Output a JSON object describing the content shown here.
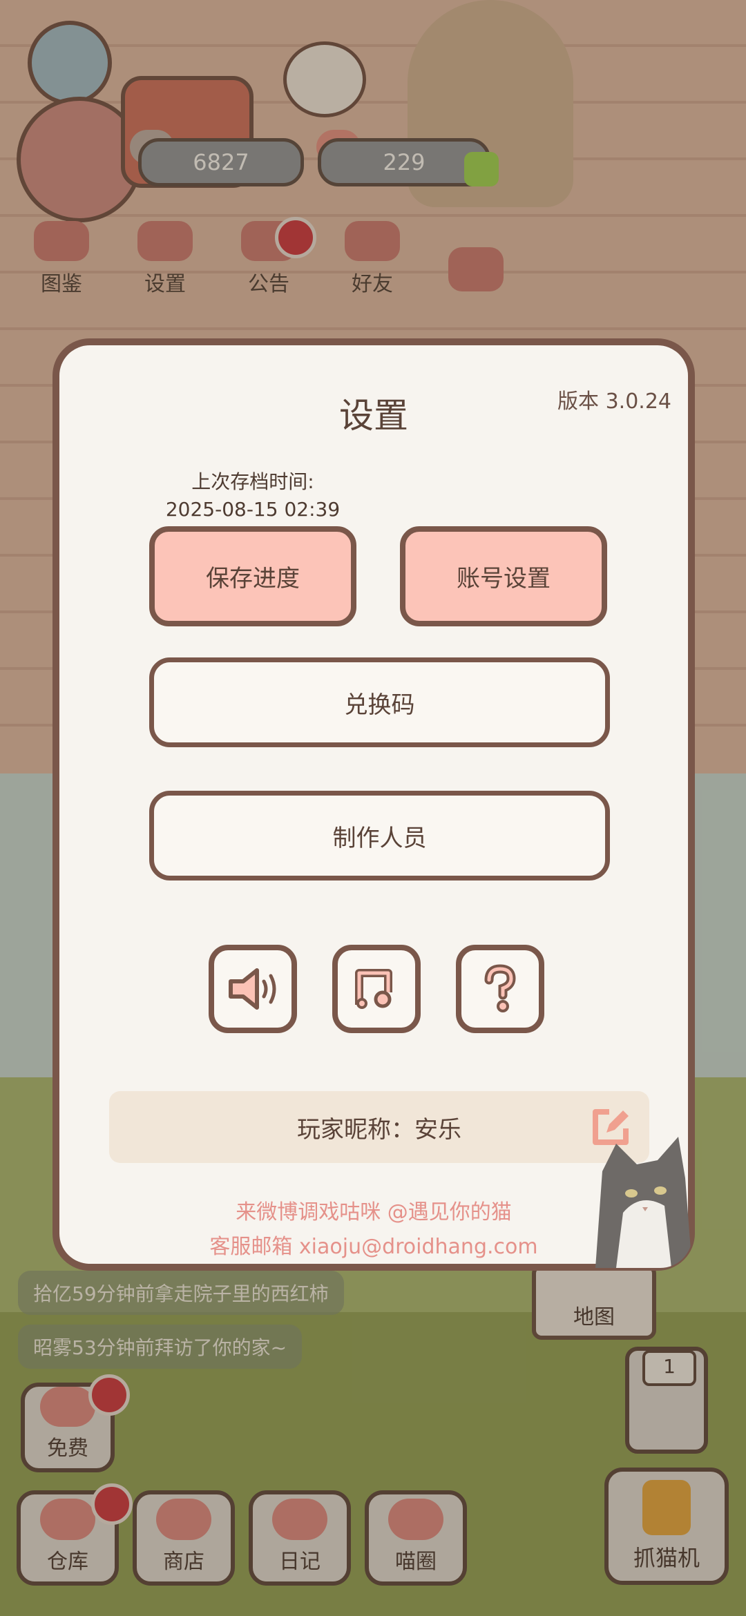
{
  "top_stats": {
    "coins": "6827",
    "fish": "229"
  },
  "top_nav": [
    {
      "label": "图鉴",
      "icon": "cat-book-icon"
    },
    {
      "label": "设置",
      "icon": "gear-icon"
    },
    {
      "label": "公告",
      "icon": "gift-icon"
    },
    {
      "label": "好友",
      "icon": "friends-icon"
    },
    {
      "label": "",
      "icon": "hearts-icon"
    }
  ],
  "dialog": {
    "title": "设置",
    "version": "版本 3.0.24",
    "last_save_label": "上次存档时间:",
    "last_save_time": "2025-08-15 02:39",
    "save_button": "保存进度",
    "account_button": "账号设置",
    "redeem_button": "兑换码",
    "credits_button": "制作人员",
    "icons": [
      "speaker-icon",
      "music-note-icon",
      "question-icon"
    ],
    "nickname": "玩家昵称：安乐",
    "social_text": "来微博调戏咕咪 @遇见你的猫",
    "email_text": "客服邮箱 xiaoju@droidhang.com"
  },
  "feed": [
    "拾亿59分钟前拿走院子里的西红柿",
    "昭雾53分钟前拜访了你的家~"
  ],
  "map_label": "地图",
  "elevator_floor": "1",
  "claw_label": "抓猫机",
  "free_label": "免费",
  "bottom_nav": [
    {
      "label": "仓库",
      "icon": "storage-icon"
    },
    {
      "label": "商店",
      "icon": "shop-icon"
    },
    {
      "label": "日记",
      "icon": "diary-icon"
    },
    {
      "label": "喵圈",
      "icon": "cat-planet-icon"
    }
  ],
  "colors": {
    "accent": "#fcc4b8",
    "border": "#7a574a",
    "link": "#e5918a",
    "badge": "#c8353b"
  }
}
